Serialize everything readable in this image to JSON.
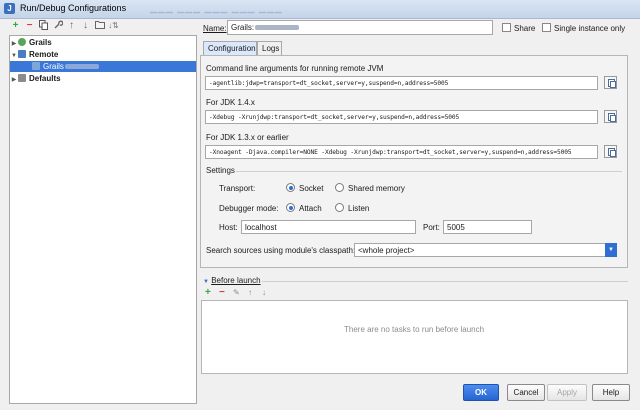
{
  "window": {
    "title": "Run/Debug Configurations"
  },
  "toolbar": {
    "icons": [
      "plus-icon",
      "minus-icon",
      "copy-icon",
      "wrench-icon",
      "arrow-up-icon",
      "arrow-down-icon",
      "folder-icon",
      "sort-icon"
    ]
  },
  "tree": {
    "items": [
      {
        "label": "Grails",
        "level": 0
      },
      {
        "label": "Remote",
        "level": 0
      },
      {
        "label": "Grails",
        "level": 1,
        "selected": true
      },
      {
        "label": "Defaults",
        "level": 0
      }
    ]
  },
  "name_field": {
    "label": "Name:",
    "value": "Grails:"
  },
  "share": {
    "label": "Share",
    "checked": false
  },
  "single_instance": {
    "label": "Single instance only",
    "checked": false
  },
  "tabs": [
    {
      "label": "Configuration",
      "active": true
    },
    {
      "label": "Logs",
      "active": false
    }
  ],
  "config": {
    "cmd_label": "Command line arguments for running remote JVM",
    "cmd_value": "-agentlib:jdwp=transport=dt_socket,server=y,suspend=n,address=5005",
    "jdk14_label": "For JDK 1.4.x",
    "jdk14_value": "-Xdebug -Xrunjdwp:transport=dt_socket,server=y,suspend=n,address=5005",
    "jdk13_label": "For JDK 1.3.x or earlier",
    "jdk13_value": "-Xnoagent -Djava.compiler=NONE -Xdebug -Xrunjdwp:transport=dt_socket,server=y,suspend=n,address=5005",
    "settings_label": "Settings",
    "transport_label": "Transport:",
    "transport_socket": "Socket",
    "transport_shared": "Shared memory",
    "transport_selected": "Socket",
    "debugger_label": "Debugger mode:",
    "debugger_attach": "Attach",
    "debugger_listen": "Listen",
    "debugger_selected": "Attach",
    "host_label": "Host:",
    "host_value": "localhost",
    "port_label": "Port:",
    "port_value": "5005",
    "classpath_label": "Search sources using module's classpath:",
    "classpath_value": "<whole project>"
  },
  "before_launch": {
    "label": "Before launch",
    "empty_text": "There are no tasks to run before launch"
  },
  "buttons": {
    "ok": "OK",
    "cancel": "Cancel",
    "apply": "Apply",
    "help": "Help"
  },
  "colors": {
    "accent": "#3b77d7",
    "primary_button": "#2565d0"
  }
}
